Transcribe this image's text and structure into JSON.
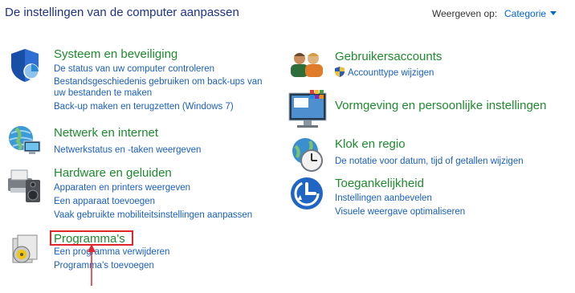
{
  "header": {
    "title": "De instellingen van de computer aanpassen",
    "view_by_label": "Weergeven op:",
    "view_by_value": "Categorie"
  },
  "left": {
    "systeem": {
      "title": "Systeem en beveiliging",
      "links": [
        "De status van uw computer controleren",
        "Bestandsgeschiedenis gebruiken om back-ups van",
        "uw bestanden te maken",
        "Back-up maken en terugzetten (Windows 7)"
      ]
    },
    "netwerk": {
      "title": "Netwerk en internet",
      "links": [
        "Netwerkstatus en -taken weergeven"
      ]
    },
    "hardware": {
      "title": "Hardware en geluiden",
      "links": [
        "Apparaten en printers weergeven",
        "Een apparaat toevoegen",
        "Vaak gebruikte mobiliteitsinstellingen aanpassen"
      ]
    },
    "programmas": {
      "title": "Programma's",
      "links": [
        "Een programma verwijderen",
        "Programma's toevoegen"
      ]
    }
  },
  "right": {
    "gebruikers": {
      "title": "Gebruikersaccounts",
      "links": [
        "Accounttype wijzigen"
      ]
    },
    "vormgeving": {
      "title": "Vormgeving en persoonlijke instellingen",
      "links": []
    },
    "klok": {
      "title": "Klok en regio",
      "links": [
        "De notatie voor datum, tijd of getallen wijzigen"
      ]
    },
    "toegankelijkheid": {
      "title": "Toegankelijkheid",
      "links": [
        "Instellingen aanbevelen",
        "Visuele weergave optimaliseren"
      ]
    }
  },
  "colors": {
    "category_title": "#1e8a2e",
    "link": "#1a5fbf",
    "highlight": "#e0262a"
  }
}
